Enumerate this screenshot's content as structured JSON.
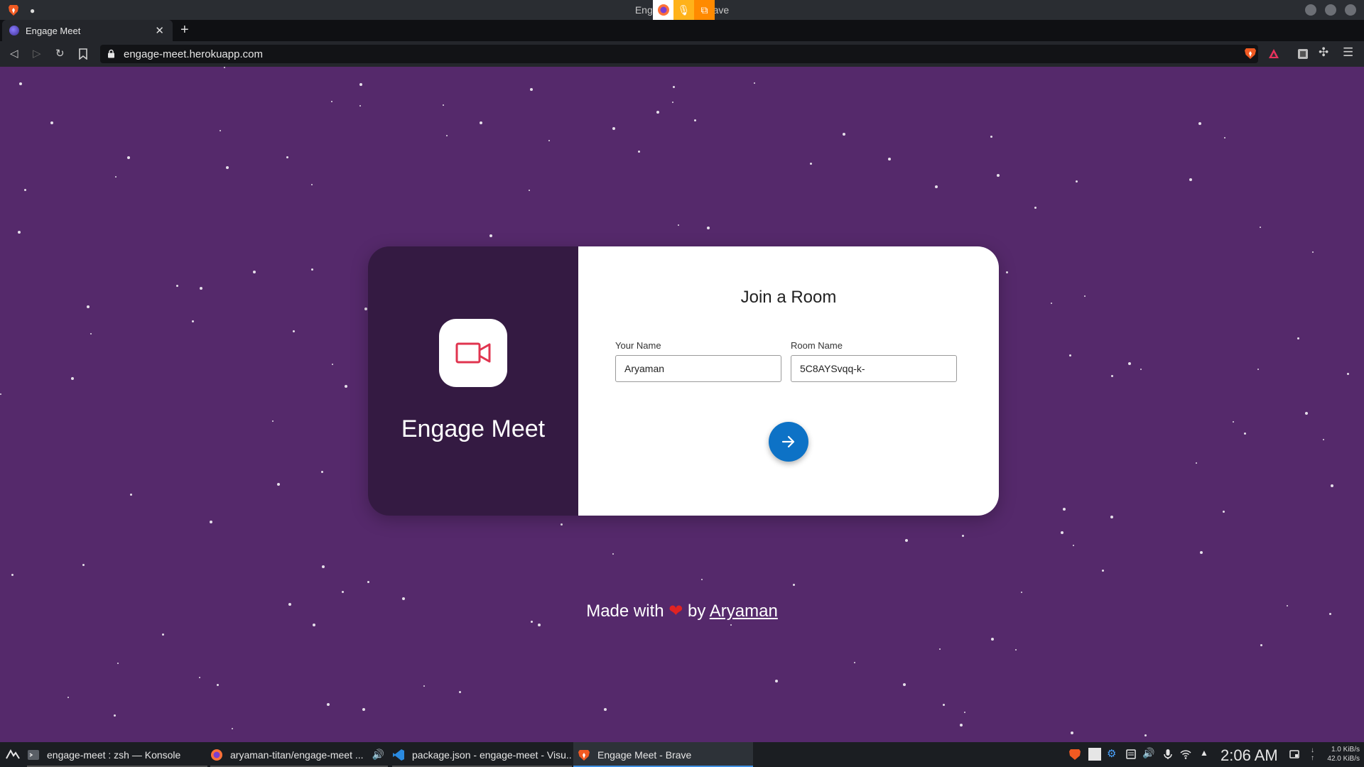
{
  "window": {
    "title": "Engage Meet - Brave"
  },
  "tabs": [
    {
      "label": "Engage Meet"
    }
  ],
  "address_bar": {
    "url": "engage-meet.herokuapp.com"
  },
  "page": {
    "brand_name": "Engage Meet",
    "form": {
      "title": "Join a Room",
      "name_label": "Your Name",
      "name_value": "Aryaman",
      "room_label": "Room Name",
      "room_value": "5C8AYSvqq-k-"
    },
    "footer": {
      "prefix": "Made with",
      "heart": "❤",
      "by": "by",
      "author": "Aryaman"
    },
    "colors": {
      "background": "#55296b",
      "card_left": "#341a42",
      "button": "#0d72c6",
      "icon": "#e0344f"
    }
  },
  "taskbar": {
    "tasks": [
      {
        "label": "engage-meet : zsh — Konsole",
        "icon": "terminal-icon"
      },
      {
        "label": "aryaman-titan/engage-meet ...",
        "icon": "firefox-icon"
      },
      {
        "label": "package.json - engage-meet - Visu...",
        "icon": "vscode-icon"
      },
      {
        "label": "Engage Meet - Brave",
        "icon": "brave-icon"
      }
    ],
    "clock": "2:06 AM",
    "net_down": "1.0 KiB/s",
    "net_up": "42.0 KiB/s"
  }
}
